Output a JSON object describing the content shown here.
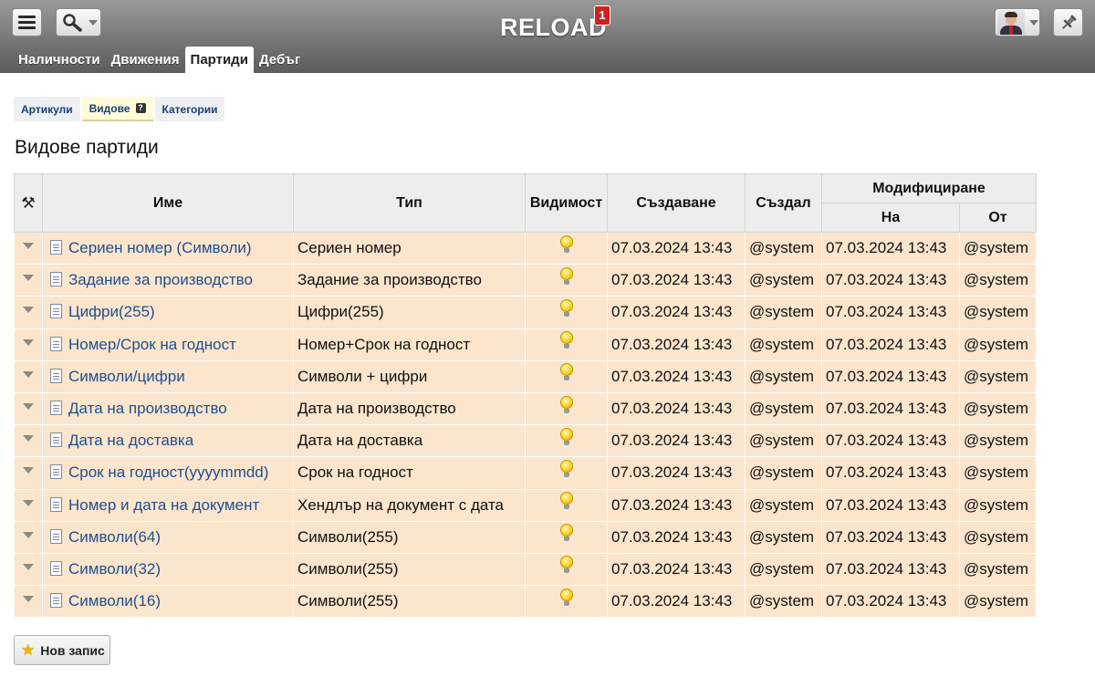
{
  "header": {
    "title": "RELOAD",
    "notification_count": "1",
    "menu_icon": "hamburger-menu-icon",
    "search_icon": "search-icon",
    "user_icon": "avatar",
    "pin_icon": "pin-icon"
  },
  "main_tabs": [
    {
      "label": "Наличности",
      "active": false
    },
    {
      "label": "Движения",
      "active": false
    },
    {
      "label": "Партиди",
      "active": true
    },
    {
      "label": "Дебъг",
      "active": false
    }
  ],
  "sub_tabs": [
    {
      "label": "Артикули",
      "active": false
    },
    {
      "label": "Видове",
      "active": true,
      "help": "?"
    },
    {
      "label": "Категории",
      "active": false
    }
  ],
  "page_title": "Видове партиди",
  "table": {
    "headers": {
      "tools_icon": "⚒",
      "name": "Име",
      "type": "Тип",
      "visibility": "Видимост",
      "created": "Създаване",
      "created_by": "Създал",
      "modified": "Модифициране",
      "modified_on": "На",
      "modified_by": "От"
    },
    "rows": [
      {
        "name": "Сериен номер (Символи)",
        "type": "Сериен номер",
        "created": "07.03.2024 13:43",
        "created_by": "@system",
        "modified_on": "07.03.2024 13:43",
        "modified_by": "@system"
      },
      {
        "name": "Задание за производство",
        "type": "Задание за производство",
        "created": "07.03.2024 13:43",
        "created_by": "@system",
        "modified_on": "07.03.2024 13:43",
        "modified_by": "@system"
      },
      {
        "name": "Цифри(255)",
        "type": "Цифри(255)",
        "created": "07.03.2024 13:43",
        "created_by": "@system",
        "modified_on": "07.03.2024 13:43",
        "modified_by": "@system"
      },
      {
        "name": "Номер/Срок на годност",
        "type": "Номер+Срок на годност",
        "created": "07.03.2024 13:43",
        "created_by": "@system",
        "modified_on": "07.03.2024 13:43",
        "modified_by": "@system"
      },
      {
        "name": "Символи/цифри",
        "type": "Символи + цифри",
        "created": "07.03.2024 13:43",
        "created_by": "@system",
        "modified_on": "07.03.2024 13:43",
        "modified_by": "@system"
      },
      {
        "name": "Дата на производство",
        "type": "Дата на производство",
        "created": "07.03.2024 13:43",
        "created_by": "@system",
        "modified_on": "07.03.2024 13:43",
        "modified_by": "@system"
      },
      {
        "name": "Дата на доставка",
        "type": "Дата на доставка",
        "created": "07.03.2024 13:43",
        "created_by": "@system",
        "modified_on": "07.03.2024 13:43",
        "modified_by": "@system"
      },
      {
        "name": "Срок на годност(yyyymmdd)",
        "type": "Срок на годност",
        "created": "07.03.2024 13:43",
        "created_by": "@system",
        "modified_on": "07.03.2024 13:43",
        "modified_by": "@system"
      },
      {
        "name": "Номер и дата на документ",
        "type": "Хендлър на документ с дата",
        "created": "07.03.2024 13:43",
        "created_by": "@system",
        "modified_on": "07.03.2024 13:43",
        "modified_by": "@system"
      },
      {
        "name": "Символи(64)",
        "type": "Символи(255)",
        "created": "07.03.2024 13:43",
        "created_by": "@system",
        "modified_on": "07.03.2024 13:43",
        "modified_by": "@system"
      },
      {
        "name": "Символи(32)",
        "type": "Символи(255)",
        "created": "07.03.2024 13:43",
        "created_by": "@system",
        "modified_on": "07.03.2024 13:43",
        "modified_by": "@system"
      },
      {
        "name": "Символи(16)",
        "type": "Символи(255)",
        "created": "07.03.2024 13:43",
        "created_by": "@system",
        "modified_on": "07.03.2024 13:43",
        "modified_by": "@system"
      }
    ]
  },
  "new_record_label": "Нов запис",
  "colors": {
    "header_gradient_top": "#9a9a9a",
    "header_gradient_bottom": "#5c5c5c",
    "row_background": "#fbe5cc",
    "link": "#1f4f8f",
    "active_subtab": "#fffbd9",
    "badge": "#d02020"
  }
}
